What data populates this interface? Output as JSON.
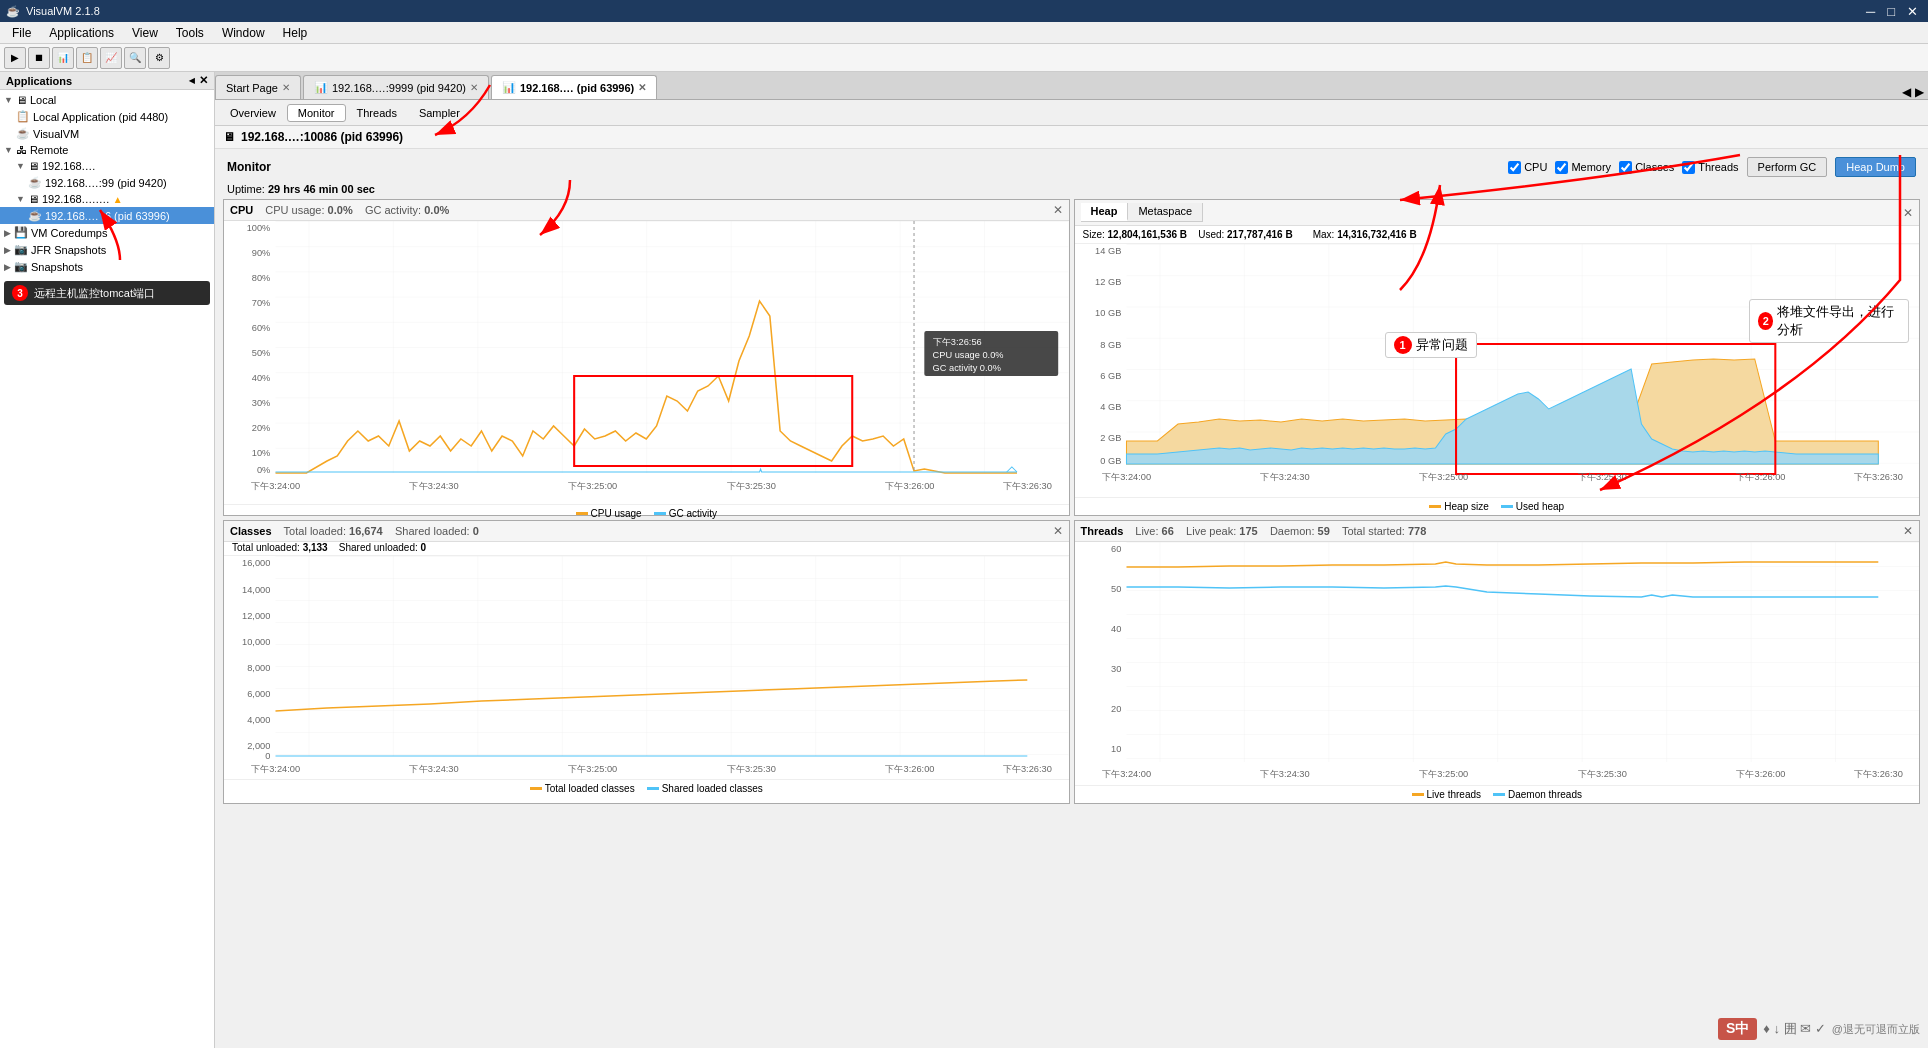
{
  "app": {
    "title": "VisualVM 2.1.8",
    "icon": "☕"
  },
  "titlebar": {
    "controls": [
      "─",
      "□",
      "✕"
    ]
  },
  "menubar": {
    "items": [
      "File",
      "Applications",
      "View",
      "Tools",
      "Window",
      "Help"
    ]
  },
  "sidebar": {
    "header": "Applications",
    "close": "✕",
    "collapse": "◂",
    "tree": [
      {
        "label": "Local",
        "level": 0,
        "type": "folder",
        "expanded": true
      },
      {
        "label": "Local Application (pid 4480)",
        "level": 1,
        "type": "app"
      },
      {
        "label": "VisualVM",
        "level": 1,
        "type": "app"
      },
      {
        "label": "Remote",
        "level": 0,
        "type": "folder",
        "expanded": true
      },
      {
        "label": "192.168.…",
        "level": 1,
        "type": "server",
        "expanded": true
      },
      {
        "label": "192.168.…:99 (pid 9420)",
        "level": 2,
        "type": "process"
      },
      {
        "label": "192.168.….…",
        "level": 1,
        "type": "server",
        "expanded": true
      },
      {
        "label": "192.168.… :6 (pid 63996)",
        "level": 2,
        "type": "process",
        "selected": true
      },
      {
        "label": "VM Coredumps",
        "level": 0,
        "type": "folder"
      },
      {
        "label": "JFR Snapshots",
        "level": 0,
        "type": "folder"
      },
      {
        "label": "Snapshots",
        "level": 0,
        "type": "folder"
      }
    ],
    "tooltip": "远程主机监控tomcat端口"
  },
  "tabs": [
    {
      "label": "Start Page",
      "closable": true
    },
    {
      "label": "192.168.…:9999 (pid 9420)",
      "closable": true
    },
    {
      "label": "192.168.… (pid 63996)",
      "closable": true,
      "active": true
    }
  ],
  "subtabs": [
    "Overview",
    "Monitor",
    "Threads",
    "Sampler"
  ],
  "active_subtab": "Monitor",
  "page_header": {
    "icon": "🖥",
    "title": "192.168.…:10086 (pid 63996)"
  },
  "monitor": {
    "section_title": "Monitor",
    "uptime_label": "Uptime:",
    "uptime_value": "29 hrs 46 min 00 sec",
    "checkboxes": [
      "CPU",
      "Memory",
      "Classes",
      "Threads"
    ],
    "buttons": [
      "Perform GC",
      "Heap Dump"
    ]
  },
  "cpu_chart": {
    "title": "CPU",
    "usage_label": "CPU usage:",
    "usage_value": "0.0%",
    "gc_label": "GC activity:",
    "gc_value": "0.0%",
    "y_axis": [
      "100%",
      "90%",
      "80%",
      "70%",
      "60%",
      "50%",
      "40%",
      "30%",
      "20%",
      "10%",
      "0%"
    ],
    "x_axis": [
      "下午3:24:00",
      "下午3:24:30",
      "下午3:25:00",
      "下午3:25:30",
      "下午3:26:00",
      "下午3:26:30"
    ],
    "legend": [
      {
        "label": "CPU usage",
        "color": "#f5a623"
      },
      {
        "label": "GC activity",
        "color": "#4fc3f7"
      }
    ],
    "tooltip": {
      "time": "下午3:26:56",
      "cpu": "CPU usage  0.0%",
      "gc": "GC activity  0.0%"
    }
  },
  "heap_chart": {
    "tabs": [
      "Heap",
      "Metaspace"
    ],
    "active_tab": "Heap",
    "size_label": "Size:",
    "size_value": "12,804,161,536 B",
    "max_label": "Max:",
    "max_value": "14,316,732,416 B",
    "used_label": "Used:",
    "used_value": "217,787,416 B",
    "y_axis": [
      "14 GB",
      "12 GB",
      "10 GB",
      "8 GB",
      "6 GB",
      "4 GB",
      "2 GB",
      "0 GB"
    ],
    "x_axis": [
      "下午3:24:00",
      "下午3:24:30",
      "下午3:25:00",
      "下午3:25:30",
      "下午3:26:00",
      "下午3:26:30"
    ],
    "legend": [
      {
        "label": "Heap size",
        "color": "#f5a623"
      },
      {
        "label": "Used heap",
        "color": "#4fc3f7"
      }
    ]
  },
  "classes_chart": {
    "title": "Classes",
    "total_loaded_label": "Total loaded:",
    "total_loaded_value": "16,674",
    "total_unloaded_label": "Total unloaded:",
    "total_unloaded_value": "3,133",
    "shared_loaded_label": "Shared loaded:",
    "shared_loaded_value": "0",
    "shared_unloaded_label": "Shared unloaded:",
    "shared_unloaded_value": "0",
    "x_axis": [
      "下午3:24:00",
      "下午3:24:30",
      "下午3:25:00",
      "下午3:25:30",
      "下午3:26:00",
      "下午3:26:30"
    ],
    "legend": [
      {
        "label": "Total loaded classes",
        "color": "#f5a623"
      },
      {
        "label": "Shared loaded classes",
        "color": "#4fc3f7"
      }
    ]
  },
  "threads_chart": {
    "title": "Threads",
    "live_label": "Live:",
    "live_value": "66",
    "live_peak_label": "Live peak:",
    "live_peak_value": "175",
    "daemon_label": "Daemon:",
    "daemon_value": "59",
    "total_started_label": "Total started:",
    "total_started_value": "778",
    "x_axis": [
      "下午3:24:00",
      "下午3:24:30",
      "下午3:25:00",
      "下午3:25:30",
      "下午3:26:00",
      "下午3:26:30"
    ],
    "legend": [
      {
        "label": "Live threads",
        "color": "#f5a623"
      },
      {
        "label": "Daemon threads",
        "color": "#4fc3f7"
      }
    ]
  },
  "annotations": {
    "tooltip_label": "远程主机监控tomcat端口",
    "annotation1_label": "异常问题",
    "annotation2_label": "将堆文件导出，进行分析"
  },
  "watermark": {
    "logo": "S中",
    "icons": "♦ ↓ 囲 ✉ ✓"
  }
}
